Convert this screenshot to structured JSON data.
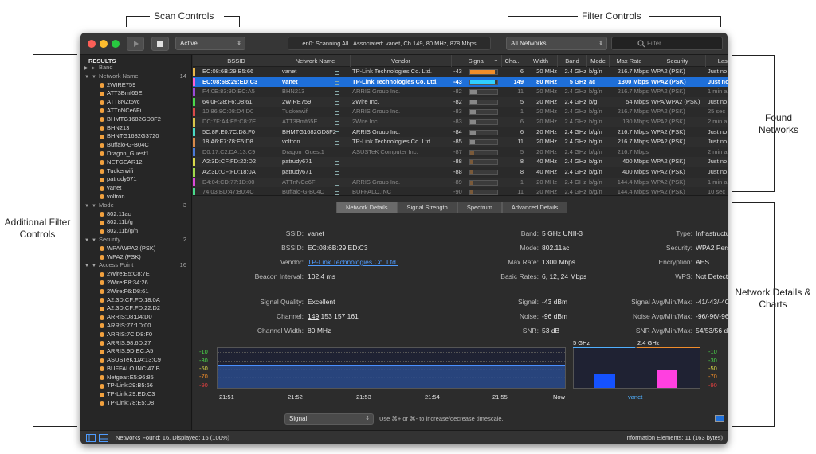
{
  "callouts": {
    "scan": "Scan Controls",
    "filter": "Filter Controls",
    "found": "Found Networks",
    "additional": "Additional Filter Controls",
    "details": "Network Details & Charts"
  },
  "toolbar": {
    "scan_mode": "Active",
    "status": "en0: Scanning All  |  Associated: vanet, Ch 149, 80 MHz, 878 Mbps",
    "network_filter": "All Networks",
    "filter_placeholder": "Filter"
  },
  "sidebar": {
    "title": "RESULTS",
    "band": {
      "label": "Band"
    },
    "network_name": {
      "label": "Network Name",
      "count": "14",
      "items": [
        "2WIRE759",
        "ATT3Bmf65E",
        "ATT8NZt5vc",
        "ATTnNCe6Fi",
        "BHMTG1682GD8F2",
        "BHN213",
        "BHNTG1682G3720",
        "Buffalo-G-B04C",
        "Dragon_Guest1",
        "NETGEAR12",
        "Tuckerwifi",
        "patrudy671",
        "vanet",
        "voltron"
      ]
    },
    "mode": {
      "label": "Mode",
      "count": "3",
      "items": [
        "802.11ac",
        "802.11b/g",
        "802.11b/g/n"
      ]
    },
    "security": {
      "label": "Security",
      "count": "2",
      "items": [
        "WPA/WPA2 (PSK)",
        "WPA2 (PSK)"
      ]
    },
    "access_point": {
      "label": "Access Point",
      "count": "16",
      "items": [
        "2Wire:E5:C8:7E",
        "2Wire:E8:34:26",
        "2Wire:F6:D8:61",
        "A2:3D:CF:FD:18:0A",
        "A2:3D:CF:FD:22:D2",
        "ARRIS:08:D4:D0",
        "ARRIS:77:1D:00",
        "ARRIS:7C:D8:F0",
        "ARRIS:98:6D:27",
        "ARRIS:9D:EC:A5",
        "ASUSTeK:DA:13:C9",
        "BUFFALO.INC:47:B...",
        "Netgear:E5:96:85",
        "TP-Link:29:B5:66",
        "TP-Link:29:ED:C3",
        "TP-Link:78:E5:D8"
      ]
    }
  },
  "table": {
    "headers": [
      "BSSID",
      "Network Name",
      "Vendor",
      "Signal",
      "Cha...",
      "Width",
      "Band",
      "Mode",
      "Max Rate",
      "Security",
      "Last Se"
    ],
    "rows": [
      {
        "bssid": "EC:08:6B:29:B5:66",
        "name": "vanet",
        "vendor": "TP-Link Technologies Co. Ltd.",
        "signal": "-43",
        "pct": 0.9,
        "ch": "6",
        "width": "20 MHz",
        "band": "2.4 GHz",
        "mode": "b/g/n",
        "rate": "216.7 Mbps",
        "sec": "WPA2 (PSK)",
        "last": "Just no",
        "color": "#e8b64a",
        "dim": false,
        "sel": false
      },
      {
        "bssid": "EC:08:6B:29:ED:C3",
        "name": "vanet",
        "vendor": "TP-Link Technologies Co. Ltd.",
        "signal": "-43",
        "pct": 0.9,
        "ch": "149",
        "width": "80 MHz",
        "band": "5 GHz",
        "mode": "ac",
        "rate": "1300 Mbps",
        "sec": "WPA2 (PSK)",
        "last": "Just no",
        "color": "#ff60d0",
        "dim": false,
        "sel": true
      },
      {
        "bssid": "F4:0E:83:9D:EC:A5",
        "name": "BHN213",
        "vendor": "ARRIS Group Inc.",
        "signal": "-82",
        "pct": 0.25,
        "ch": "11",
        "width": "20 MHz",
        "band": "2.4 GHz",
        "mode": "b/g/n",
        "rate": "216.7 Mbps",
        "sec": "WPA2 (PSK)",
        "last": "1 min a",
        "color": "#9a4ad9",
        "dim": true,
        "sel": false
      },
      {
        "bssid": "64:0F:28:F6:D8:61",
        "name": "2WIRE759",
        "vendor": "2Wire Inc.",
        "signal": "-82",
        "pct": 0.25,
        "ch": "5",
        "width": "20 MHz",
        "band": "2.4 GHz",
        "mode": "b/g",
        "rate": "54 Mbps",
        "sec": "WPA/WPA2 (PSK)",
        "last": "Just no",
        "color": "#4ad94a",
        "dim": false,
        "sel": false
      },
      {
        "bssid": "10:86:8C:08:D4:D0",
        "name": "Tuckerwifi",
        "vendor": "ARRIS Group Inc.",
        "signal": "-83",
        "pct": 0.22,
        "ch": "1",
        "width": "20 MHz",
        "band": "2.4 GHz",
        "mode": "b/g/n",
        "rate": "216.7 Mbps",
        "sec": "WPA2 (PSK)",
        "last": "25 sec",
        "color": "#d94a4a",
        "dim": true,
        "sel": false
      },
      {
        "bssid": "DC:7F:A4:E5:C8:7E",
        "name": "ATT3Bmf65E",
        "vendor": "2Wire Inc.",
        "signal": "-83",
        "pct": 0.22,
        "ch": "6",
        "width": "20 MHz",
        "band": "2.4 GHz",
        "mode": "b/g/n",
        "rate": "130 Mbps",
        "sec": "WPA2 (PSK)",
        "last": "2 min a",
        "color": "#d9c44a",
        "dim": true,
        "sel": false
      },
      {
        "bssid": "5C:8F:E0:7C:D8:F0",
        "name": "BHMTG1682GD8F2",
        "vendor": "ARRIS Group Inc.",
        "signal": "-84",
        "pct": 0.2,
        "ch": "6",
        "width": "20 MHz",
        "band": "2.4 GHz",
        "mode": "b/g/n",
        "rate": "216.7 Mbps",
        "sec": "WPA2 (PSK)",
        "last": "Just no",
        "color": "#4ad9c4",
        "dim": false,
        "sel": false
      },
      {
        "bssid": "18:A6:F7:78:E5:D8",
        "name": "voltron",
        "vendor": "TP-Link Technologies Co. Ltd.",
        "signal": "-85",
        "pct": 0.18,
        "ch": "11",
        "width": "20 MHz",
        "band": "2.4 GHz",
        "mode": "b/g/n",
        "rate": "216.7 Mbps",
        "sec": "WPA2 (PSK)",
        "last": "Just no",
        "color": "#d98a4a",
        "dim": false,
        "sel": false
      },
      {
        "bssid": "D0:17:C2:DA:13:C9",
        "name": "Dragon_Guest1",
        "vendor": "ASUSTeK Computer Inc.",
        "signal": "-87",
        "pct": 0.15,
        "ch": "5",
        "width": "20 MHz",
        "band": "2.4 GHz",
        "mode": "b/g/n",
        "rate": "216.7 Mbps",
        "sec": "",
        "last": "2 min a",
        "color": "#4a7ad9",
        "dim": true,
        "sel": false
      },
      {
        "bssid": "A2:3D:CF:FD:22:D2",
        "name": "patrudy671",
        "vendor": "",
        "signal": "-88",
        "pct": 0.12,
        "ch": "8",
        "width": "40 MHz",
        "band": "2.4 GHz",
        "mode": "b/g/n",
        "rate": "400 Mbps",
        "sec": "WPA2 (PSK)",
        "last": "Just no",
        "color": "#d9d94a",
        "dim": false,
        "sel": false
      },
      {
        "bssid": "A2:3D:CF:FD:18:0A",
        "name": "patrudy671",
        "vendor": "",
        "signal": "-88",
        "pct": 0.12,
        "ch": "8",
        "width": "40 MHz",
        "band": "2.4 GHz",
        "mode": "b/g/n",
        "rate": "400 Mbps",
        "sec": "WPA2 (PSK)",
        "last": "Just no",
        "color": "#a0d94a",
        "dim": false,
        "sel": false
      },
      {
        "bssid": "D4:04:CD:77:1D:00",
        "name": "ATTnNCe6Fi",
        "vendor": "ARRIS Group Inc.",
        "signal": "-89",
        "pct": 0.1,
        "ch": "1",
        "width": "20 MHz",
        "band": "2.4 GHz",
        "mode": "b/g/n",
        "rate": "144.4 Mbps",
        "sec": "WPA2 (PSK)",
        "last": "1 min a",
        "color": "#d94ad9",
        "dim": true,
        "sel": false
      },
      {
        "bssid": "74:03:BD:47:B0:4C",
        "name": "Buffalo-G-B04C",
        "vendor": "BUFFALO.INC",
        "signal": "-90",
        "pct": 0.08,
        "ch": "11",
        "width": "20 MHz",
        "band": "2.4 GHz",
        "mode": "b/g/n",
        "rate": "144.4 Mbps",
        "sec": "WPA2 (PSK)",
        "last": "10 sec",
        "color": "#4ad98a",
        "dim": true,
        "sel": false
      }
    ]
  },
  "tabs": [
    "Network Details",
    "Signal Strength",
    "Spectrum",
    "Advanced Details"
  ],
  "details": {
    "ssid_k": "SSID:",
    "ssid": "vanet",
    "bssid_k": "BSSID:",
    "bssid": "EC:08:6B:29:ED:C3",
    "vendor_k": "Vendor:",
    "vendor": "TP-Link Technologies Co. Ltd.",
    "beacon_k": "Beacon Interval:",
    "beacon": "102.4 ms",
    "band_k": "Band:",
    "band": "5 GHz UNII-3",
    "mode_k": "Mode:",
    "mode": "802.11ac",
    "maxrate_k": "Max Rate:",
    "maxrate": "1300 Mbps",
    "basic_k": "Basic Rates:",
    "basic": "6, 12, 24 Mbps",
    "type_k": "Type:",
    "type": "Infrastructure",
    "security_k": "Security:",
    "security": "WPA2 Personal",
    "enc_k": "Encryption:",
    "enc": "AES",
    "wps_k": "WPS:",
    "wps": "Not Detected",
    "quality_k": "Signal Quality:",
    "quality": "Excellent",
    "channel_k": "Channel:",
    "channel_main": "149",
    "channel_rest": " 153 157 161",
    "cwidth_k": "Channel Width:",
    "cwidth": "80 MHz",
    "signal_k": "Signal:",
    "signal": "-43 dBm",
    "noise_k": "Noise:",
    "noise": "-96 dBm",
    "snr_k": "SNR:",
    "snr": "53 dB",
    "sigavg_k": "Signal Avg/Min/Max:",
    "sigavg": "-41/-43/-40 dBm",
    "noiseavg_k": "Noise Avg/Min/Max:",
    "noiseavg": "-96/-96/-96 dBm",
    "snravg_k": "SNR Avg/Min/Max:",
    "snravg": "54/53/56 dB"
  },
  "chart": {
    "yticks": [
      "-10",
      "-30",
      "-50",
      "-70",
      "-90"
    ],
    "ytick_colors": [
      "#4ad94a",
      "#4ad94a",
      "#d9d94a",
      "#f08d2a",
      "#e04040"
    ],
    "xticks": [
      "21:51",
      "21:52",
      "21:53",
      "21:54",
      "21:55",
      "Now"
    ],
    "signal_value": -43,
    "band_labels": [
      "5 GHz",
      "2.4 GHz"
    ],
    "bars": [
      {
        "value": -62,
        "color": "#1552ff"
      },
      {
        "value": -52,
        "color": "#ff40e0"
      }
    ],
    "bar_label": "vanet"
  },
  "bottom": {
    "chart_select": "Signal",
    "hint": "Use ⌘+ or ⌘- to increase/decrease timescale."
  },
  "statusbar": {
    "found": "Networks Found: 16, Displayed: 16 (100%)",
    "info": "Information Elements: 11 (163 bytes)"
  }
}
